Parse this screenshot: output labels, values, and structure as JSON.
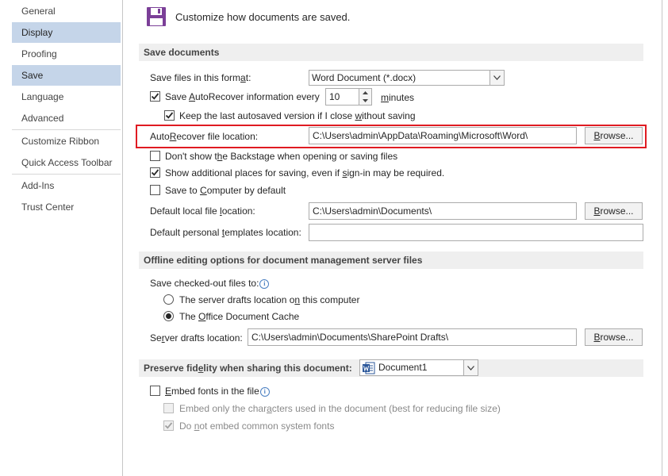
{
  "sidebar": {
    "items": [
      {
        "label": "General",
        "selected": false
      },
      {
        "label": "Display",
        "selected": true
      },
      {
        "label": "Proofing",
        "selected": false
      },
      {
        "label": "Save",
        "selected": true
      },
      {
        "label": "Language",
        "selected": false
      },
      {
        "label": "Advanced",
        "selected": false
      },
      {
        "label": "Customize Ribbon",
        "selected": false
      },
      {
        "label": "Quick Access Toolbar",
        "selected": false
      },
      {
        "label": "Add-Ins",
        "selected": false
      },
      {
        "label": "Trust Center",
        "selected": false
      }
    ]
  },
  "header": {
    "icon": "save-floppy-icon",
    "description": "Customize how documents are saved."
  },
  "save_documents": {
    "title": "Save documents",
    "format_label": "Save files in this format:",
    "format_value": "Word Document (*.docx)",
    "autorecover_label": "Save AutoRecover information every",
    "autorecover_checked": true,
    "autorecover_minutes": "10",
    "minutes_label": "minutes",
    "keep_last_label": "Keep the last autosaved version if I close without saving",
    "keep_last_checked": true,
    "autorecover_location_label": "AutoRecover file location:",
    "autorecover_location_value": "C:\\Users\\admin\\AppData\\Roaming\\Microsoft\\Word\\",
    "browse_label": "Browse...",
    "backstage_label": "Don't show the Backstage when opening or saving files",
    "backstage_checked": false,
    "additional_places_label": "Show additional places for saving, even if sign-in may be required.",
    "additional_places_checked": true,
    "save_to_computer_label": "Save to Computer by default",
    "save_to_computer_checked": false,
    "default_local_label": "Default local file location:",
    "default_local_value": "C:\\Users\\admin\\Documents\\",
    "default_templates_label": "Default personal templates location:",
    "default_templates_value": ""
  },
  "offline": {
    "title": "Offline editing options for document management server files",
    "checked_out_label": "Save checked-out files to:",
    "server_drafts_option": "The server drafts location on this computer",
    "server_drafts_selected": false,
    "office_cache_option": "The Office Document Cache",
    "office_cache_selected": true,
    "server_drafts_location_label": "Server drafts location:",
    "server_drafts_location_value": "C:\\Users\\admin\\Documents\\SharePoint Drafts\\"
  },
  "fidelity": {
    "title": "Preserve fidelity when sharing this document:",
    "document_value": "Document1",
    "embed_fonts_label": "Embed fonts in the file",
    "embed_fonts_checked": false,
    "embed_chars_label": "Embed only the characters used in the document (best for reducing file size)",
    "embed_chars_checked": false,
    "no_common_label": "Do not embed common system fonts",
    "no_common_checked": true
  },
  "colors": {
    "selected_nav": "#c5d5e9",
    "highlight_border": "#e01b22",
    "save_icon": "#7b3f98",
    "word_icon": "#2b579a"
  }
}
